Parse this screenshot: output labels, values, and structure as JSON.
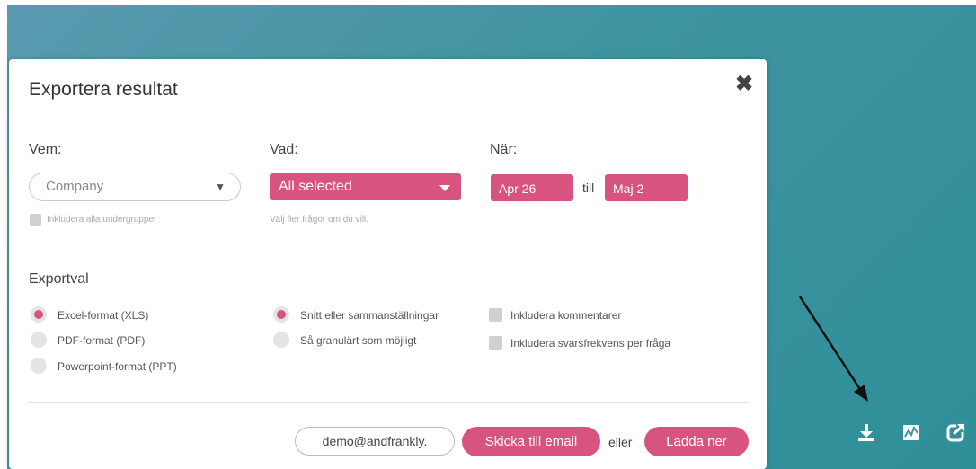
{
  "modal": {
    "title": "Exportera resultat",
    "close": "✖"
  },
  "who": {
    "label": "Vem:",
    "select_value": "Company",
    "include_subgroups": "Inkludera alla undergrupper"
  },
  "what": {
    "label": "Vad:",
    "select_value": "All selected",
    "hint": "Välj fler frågor om du vill."
  },
  "when": {
    "label": "När:",
    "from": "Apr 26",
    "separator": "till",
    "to": "Maj 2"
  },
  "export": {
    "heading": "Exportval",
    "formats": [
      {
        "label": "Excel-format (XLS)",
        "selected": true
      },
      {
        "label": "PDF-format (PDF)",
        "selected": false
      },
      {
        "label": "Powerpoint-format (PPT)",
        "selected": false
      }
    ],
    "granularity": [
      {
        "label": "Snitt eller sammanställningar",
        "selected": true
      },
      {
        "label": "Så granulärt som möjligt",
        "selected": false
      }
    ],
    "extras": [
      {
        "label": "Inkludera kommentarer",
        "checked": false
      },
      {
        "label": "Inkludera svarsfrekvens per fråga",
        "checked": false
      }
    ]
  },
  "footer": {
    "email_value": "demo@andfrankly.",
    "send_email": "Skicka till email",
    "or": "eller",
    "download": "Ladda ner"
  },
  "colors": {
    "accent": "#d6547f",
    "background": "#3f93a0"
  },
  "side_icons": [
    "download-icon",
    "chart-icon",
    "share-icon"
  ]
}
